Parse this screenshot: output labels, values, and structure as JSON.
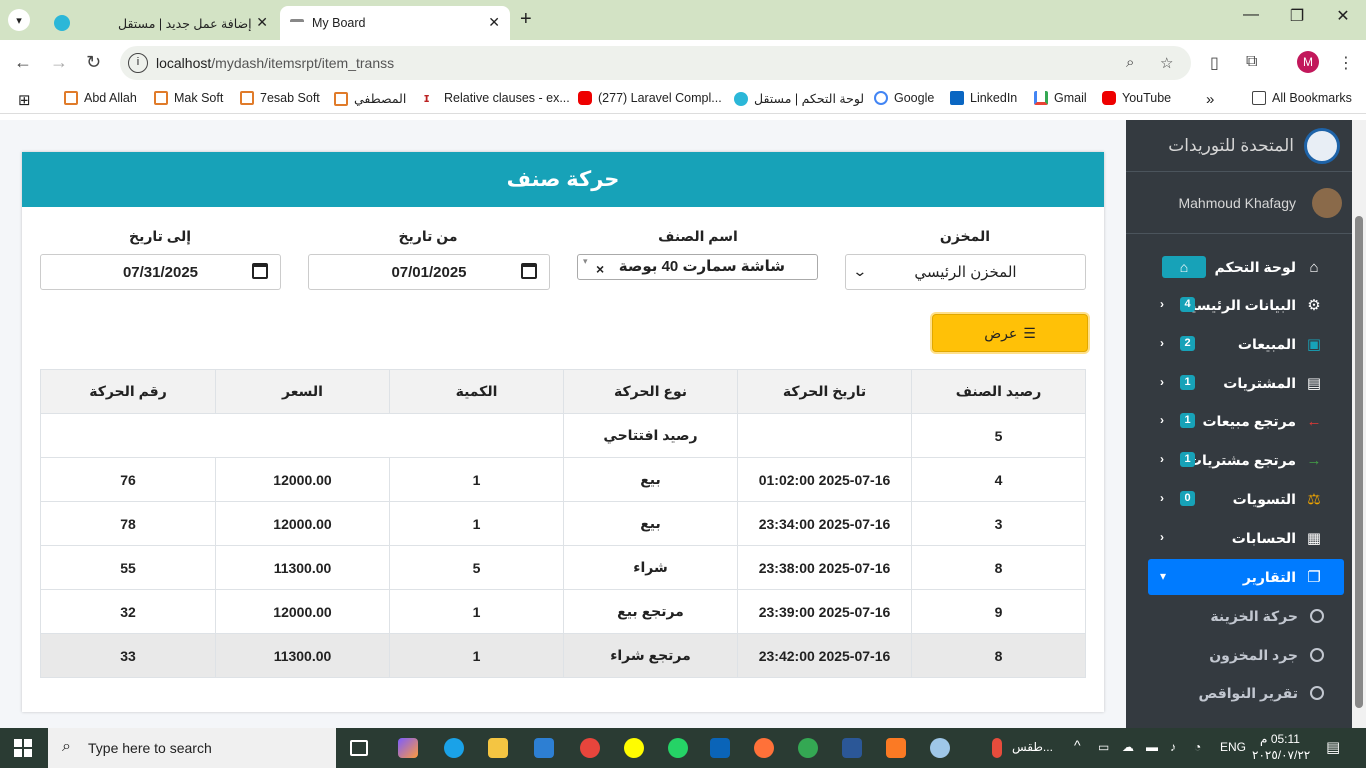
{
  "browser": {
    "tabs": [
      {
        "title": "إضافة عمل جديد | مستقل",
        "active": false
      },
      {
        "title": "My Board",
        "active": true
      }
    ],
    "url": {
      "host": "localhost",
      "path": "/mydash/itemsrpt/item_transs"
    },
    "profile_initial": "M",
    "bookmarks": [
      "Abd Allah",
      "Mak Soft",
      "7esab Soft",
      "المصطفي",
      "Relative clauses - ex...",
      "(277) Laravel Compl...",
      "لوحة التحكم | مستقل",
      "Google",
      "LinkedIn",
      "Gmail",
      "YouTube"
    ],
    "all_bookmarks": "All Bookmarks",
    "overflow": "»"
  },
  "card": {
    "title": "حركة صنف"
  },
  "filters": {
    "store_label": "المخزن",
    "store_value": "المخزن الرئيسي",
    "item_label": "اسم الصنف",
    "item_value": "شاشة سمارت 40 بوصة",
    "from_label": "من تاريخ",
    "from_value": "07/01/2025",
    "to_label": "إلى تاريخ",
    "to_value": "07/31/2025",
    "show_button": "عرض"
  },
  "table": {
    "headers": [
      "رصيد الصنف",
      "تاريخ الحركة",
      "نوع الحركة",
      "الكمية",
      "السعر",
      "رقم الحركة"
    ],
    "opening": {
      "balance": "5",
      "label": "رصيد افتتاحي"
    },
    "rows": [
      [
        "4",
        "2025-07-16 01:02:00",
        "بيع",
        "1",
        "12000.00",
        "76"
      ],
      [
        "3",
        "2025-07-16 23:34:00",
        "بيع",
        "1",
        "12000.00",
        "78"
      ],
      [
        "8",
        "2025-07-16 23:38:00",
        "شراء",
        "5",
        "11300.00",
        "55"
      ],
      [
        "9",
        "2025-07-16 23:39:00",
        "مرتجع بيع",
        "1",
        "12000.00",
        "32"
      ],
      [
        "8",
        "2025-07-16 23:42:00",
        "مرتجع شراء",
        "1",
        "11300.00",
        "33"
      ]
    ]
  },
  "sidebar": {
    "brand": "المتحدة للتوريدات",
    "user": "Mahmoud Khafagy",
    "items": [
      {
        "label": "لوحة التحكم",
        "icon": "home-icon",
        "badge": ""
      },
      {
        "label": "البيانات الرئيسية",
        "icon": "cogs-icon",
        "badge": "4"
      },
      {
        "label": "المبيعات",
        "icon": "shopping-bag-icon",
        "badge": "2"
      },
      {
        "label": "المشتريات",
        "icon": "table-icon",
        "badge": "1"
      },
      {
        "label": "مرتجع مبيعات",
        "icon": "arrow-left-icon",
        "badge": "1"
      },
      {
        "label": "مرتجع مشتريات",
        "icon": "arrow-right-icon",
        "badge": "1"
      },
      {
        "label": "التسويات",
        "icon": "balance-scale-icon",
        "badge": "0"
      },
      {
        "label": "الحسابات",
        "icon": "calculator-icon",
        "badge": ""
      },
      {
        "label": "التقارير",
        "icon": "copy-icon",
        "badge": ""
      }
    ],
    "subitems": [
      "حركة الخزينة",
      "جرد المخزون",
      "تقرير النواقص"
    ]
  },
  "taskbar": {
    "search_placeholder": "Type here to search",
    "weather": "طقس...",
    "lang": "ENG",
    "time": "05:11 م",
    "date": "٢٠٢٥/٠٧/٢٢"
  }
}
